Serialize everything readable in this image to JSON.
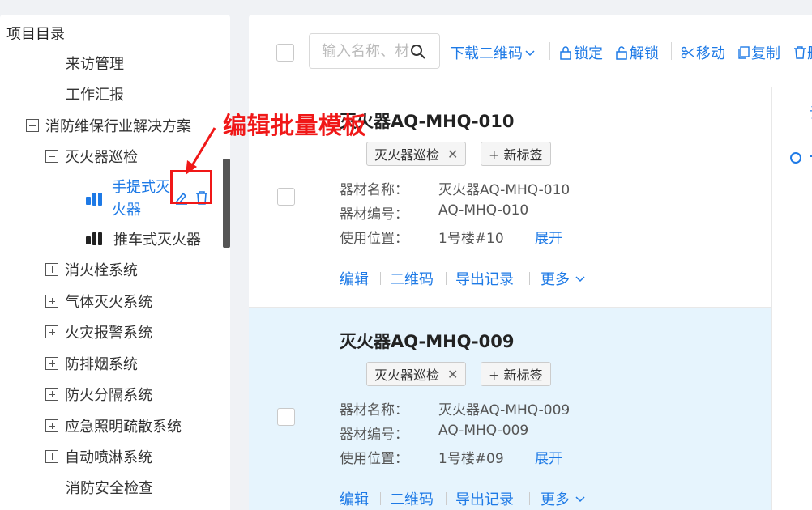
{
  "sidebar": {
    "title": "项目目录",
    "items": [
      {
        "label": "来访管理"
      },
      {
        "label": "工作汇报"
      },
      {
        "label": "消防维保行业解决方案"
      },
      {
        "label": "灭火器巡检"
      },
      {
        "label": "手提式灭火器"
      },
      {
        "label": "推车式灭火器"
      },
      {
        "label": "消火栓系统"
      },
      {
        "label": "气体灭火系统"
      },
      {
        "label": "火灾报警系统"
      },
      {
        "label": "防排烟系统"
      },
      {
        "label": "防火分隔系统"
      },
      {
        "label": "应急照明疏散系统"
      },
      {
        "label": "自动喷淋系统"
      },
      {
        "label": "消防安全检查"
      }
    ],
    "selected_line1": "手提式灭",
    "selected_line2": "火器"
  },
  "annotation": {
    "text": "编辑批量模板",
    "color": "#f01818"
  },
  "toolbar": {
    "search_placeholder": "输入名称、材",
    "download_qr": "下载二维码",
    "lock": "锁定",
    "unlock": "解锁",
    "move": "移动",
    "copy": "复制",
    "delete_partial": "删"
  },
  "cards": [
    {
      "title": "灭火器AQ-MHQ-010",
      "tag": "灭火器巡检",
      "new_tag": "+ 新标签",
      "fields": [
        {
          "label": "器材名称：",
          "value": "灭火器AQ-MHQ-010"
        },
        {
          "label": "器材编号：",
          "value": "AQ-MHQ-010"
        },
        {
          "label": "使用位置：",
          "value": "1号楼#10"
        }
      ],
      "expand": "展开",
      "actions": [
        "编辑",
        "二维码",
        "导出记录",
        "更多"
      ]
    },
    {
      "title": "灭火器AQ-MHQ-009",
      "tag": "灭火器巡检",
      "new_tag": "+ 新标签",
      "fields": [
        {
          "label": "器材名称：",
          "value": "灭火器AQ-MHQ-009"
        },
        {
          "label": "器材编号：",
          "value": "AQ-MHQ-009"
        },
        {
          "label": "使用位置：",
          "value": "1号楼#09"
        }
      ],
      "expand": "展开",
      "actions": [
        "编辑",
        "二维码",
        "导出记录",
        "更多"
      ]
    }
  ],
  "detail": {
    "tab_partial": "设"
  },
  "colors": {
    "accent": "#1e7ae6",
    "annotation": "#f01818",
    "active_card": "#e6f4fd"
  }
}
